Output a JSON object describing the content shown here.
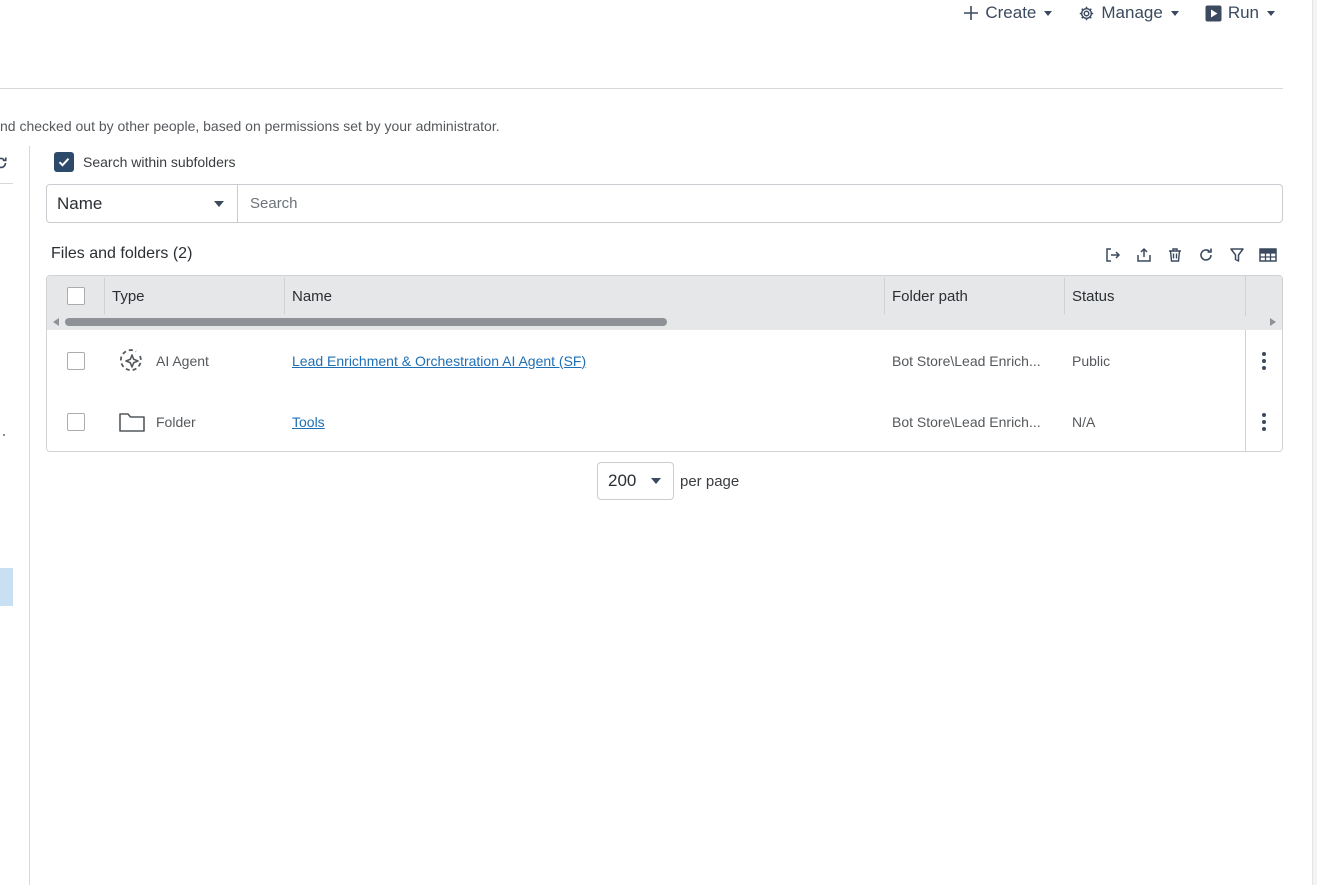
{
  "header": {
    "actions": [
      {
        "label": "Create",
        "icon": "plus-icon"
      },
      {
        "label": "Manage",
        "icon": "gear-icon"
      },
      {
        "label": "Run",
        "icon": "play-icon"
      }
    ]
  },
  "description": "nd checked out by other people, based on permissions set by your administrator.",
  "search": {
    "subfolders_label": "Search within subfolders",
    "subfolders_checked": true,
    "field_value": "Name",
    "placeholder": "Search"
  },
  "list": {
    "title": "Files and folders (2)",
    "tools": [
      "export-icon",
      "upload-icon",
      "trash-icon",
      "refresh-icon",
      "filter-icon",
      "columns-icon"
    ],
    "columns": [
      "Type",
      "Name",
      "Folder path",
      "Status"
    ],
    "rows": [
      {
        "type": "AI Agent",
        "type_icon": "ai-agent-icon",
        "name": "Lead Enrichment & Orchestration AI Agent (SF)",
        "folder_path": "Bot Store\\Lead Enrich...",
        "status": "Public"
      },
      {
        "type": "Folder",
        "type_icon": "folder-icon",
        "name": "Tools",
        "folder_path": "Bot Store\\Lead Enrich...",
        "status": "N/A"
      }
    ]
  },
  "pagination": {
    "page_size": "200",
    "label": "per page"
  },
  "colors": {
    "accent": "#2e4a6b",
    "link": "#1f6fb5",
    "header_bg": "#e6e7e8",
    "selected_nav": "#c8e0f2"
  }
}
